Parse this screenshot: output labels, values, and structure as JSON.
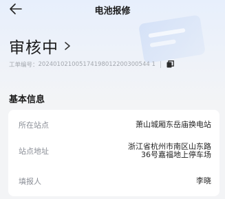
{
  "header": {
    "title": "电池报修",
    "back_icon": "arrow-left-icon"
  },
  "status": {
    "text": "审核中",
    "chevron_icon": "chevron-right-icon"
  },
  "order": {
    "label": "工单编号：",
    "number": "202401021005174198012200300544 1",
    "copy_icon": "copy-icon"
  },
  "section": {
    "title": "基本信息"
  },
  "info": {
    "rows": [
      {
        "label": "所在站点",
        "value": "萧山城厢东岳庙换电站"
      },
      {
        "label": "站点地址",
        "value_line1": "浙江省杭州市南区山东路",
        "value_line2": "36号嘉福地上停车场"
      },
      {
        "label": "填报人",
        "value": "李晓"
      }
    ]
  },
  "colors": {
    "header_gradient_top": "#e7effc",
    "page_bg": "#f3f4f6",
    "card_bg": "#ffffff",
    "muted_text": "#8a8e96"
  }
}
